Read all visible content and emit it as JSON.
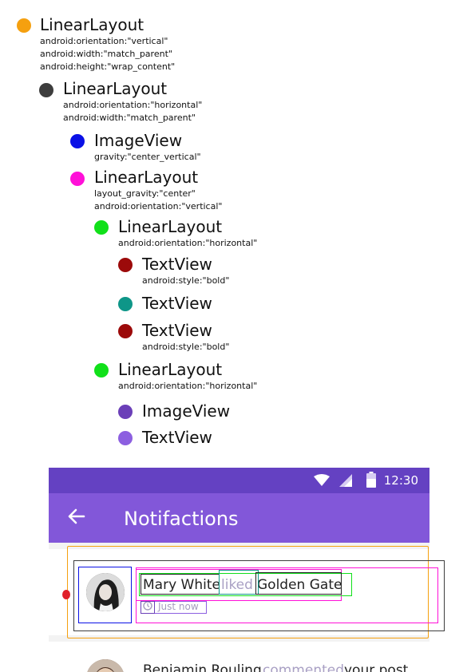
{
  "tree": [
    {
      "title": "LinearLayout",
      "color": "#f5a00f",
      "attrs": [
        "android:orientation:\"vertical\"",
        "android:width:\"match_parent\"",
        "android:height:\"wrap_content\""
      ]
    },
    {
      "title": "LinearLayout",
      "color": "#3d3d3d",
      "attrs": [
        "android:orientation:\"horizontal\"",
        "android:width:\"match_parent\""
      ]
    },
    {
      "title": "ImageView",
      "color": "#0a10e6",
      "attrs": [
        "gravity:\"center_vertical\""
      ]
    },
    {
      "title": "LinearLayout",
      "color": "#ff10d8",
      "attrs": [
        "layout_gravity:\"center\"",
        "android:orientation:\"vertical\""
      ]
    },
    {
      "title": "LinearLayout",
      "color": "#11e01a",
      "attrs": [
        "android:orientation:\"horizontal\""
      ]
    },
    {
      "title": "TextView",
      "color": "#9c0a0a",
      "attrs": [
        "android:style:\"bold\""
      ]
    },
    {
      "title": "TextView",
      "color": "#0e9688",
      "attrs": []
    },
    {
      "title": "TextView",
      "color": "#9c0a0a",
      "attrs": [
        "android:style:\"bold\""
      ]
    },
    {
      "title": "LinearLayout",
      "color": "#11e01a",
      "attrs": [
        "android:orientation:\"horizontal\""
      ]
    },
    {
      "title": "ImageView",
      "color": "#6b3fb8",
      "attrs": []
    },
    {
      "title": "TextView",
      "color": "#8c5fe0",
      "attrs": []
    }
  ],
  "phone": {
    "time": "12:30",
    "title": "Notifactions",
    "notification": {
      "name": "Mary White",
      "action": "liked",
      "target": "Golden Gate",
      "timestamp": "Just now"
    },
    "next_notification": {
      "name": "Benjamin Rouling",
      "action": "commented",
      "target": "your post"
    }
  },
  "colors": {
    "status_bar": "#6441c2",
    "app_bar": "#8257d9",
    "marker": "#e0202a"
  }
}
